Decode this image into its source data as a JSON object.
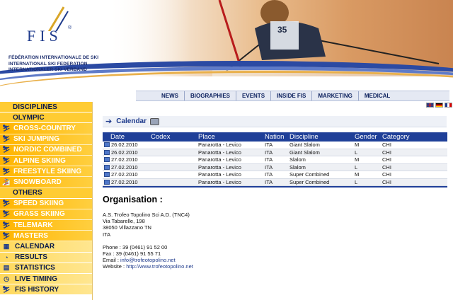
{
  "header": {
    "logo_text": "FIS",
    "logo_mark": "®",
    "federation_lines": [
      "FÉDÉRATION INTERNATIONALE DE SKI",
      "INTERNATIONAL SKI FEDERATION",
      "INTERNATIONALER SKI VERBAND"
    ],
    "photo_bib": "35"
  },
  "topnav": {
    "items": [
      "NEWS",
      "BIOGRAPHIES",
      "EVENTS",
      "INSIDE FIS",
      "MARKETING",
      "MEDICAL"
    ]
  },
  "languages": [
    "en",
    "de",
    "fr"
  ],
  "sidebar": {
    "disciplines_header": "DISCIPLINES",
    "olympic_header": "OLYMPIC",
    "olympic_items": [
      {
        "label": "CROSS-COUNTRY",
        "icon": "cross-country-icon"
      },
      {
        "label": "SKI JUMPING",
        "icon": "ski-jumping-icon"
      },
      {
        "label": "NORDIC COMBINED",
        "icon": "nordic-combined-icon"
      },
      {
        "label": "ALPINE SKIING",
        "icon": "alpine-skiing-icon"
      },
      {
        "label": "FREESTYLE SKIING",
        "icon": "freestyle-skiing-icon"
      },
      {
        "label": "SNOWBOARD",
        "icon": "snowboard-icon"
      }
    ],
    "others_header": "OTHERS",
    "other_items": [
      {
        "label": "SPEED SKIING",
        "icon": "speed-skiing-icon"
      },
      {
        "label": "GRASS SKIING",
        "icon": "grass-skiing-icon"
      },
      {
        "label": "TELEMARK",
        "icon": "telemark-icon"
      },
      {
        "label": "MASTERS",
        "icon": "masters-icon"
      }
    ],
    "extra_items": [
      {
        "label": "CALENDAR",
        "icon": "calendar-icon"
      },
      {
        "label": "RESULTS",
        "icon": "results-icon"
      },
      {
        "label": "STATISTICS",
        "icon": "statistics-icon"
      },
      {
        "label": "LIVE TIMING",
        "icon": "live-timing-icon"
      },
      {
        "label": "FIS HISTORY",
        "icon": "fis-history-icon"
      }
    ]
  },
  "main": {
    "section_title": "Calendar",
    "table": {
      "headers": {
        "date": "Date",
        "codex": "Codex",
        "place": "Place",
        "nation": "Nation",
        "discipline": "Discipline",
        "gender": "Gender",
        "category": "Category"
      },
      "rows": [
        {
          "date": "26.02.2010",
          "codex": "",
          "place": "Panarotta - Levico",
          "nation": "ITA",
          "discipline": "Giant Slalom",
          "gender": "M",
          "category": "CHI"
        },
        {
          "date": "26.02.2010",
          "codex": "",
          "place": "Panarotta - Levico",
          "nation": "ITA",
          "discipline": "Giant Slalom",
          "gender": "L",
          "category": "CHI"
        },
        {
          "date": "27.02.2010",
          "codex": "",
          "place": "Panarotta - Levico",
          "nation": "ITA",
          "discipline": "Slalom",
          "gender": "M",
          "category": "CHI"
        },
        {
          "date": "27.02.2010",
          "codex": "",
          "place": "Panarotta - Levico",
          "nation": "ITA",
          "discipline": "Slalom",
          "gender": "L",
          "category": "CHI"
        },
        {
          "date": "27.02.2010",
          "codex": "",
          "place": "Panarotta - Levico",
          "nation": "ITA",
          "discipline": "Super Combined",
          "gender": "M",
          "category": "CHI"
        },
        {
          "date": "27.02.2010",
          "codex": "",
          "place": "Panarotta - Levico",
          "nation": "ITA",
          "discipline": "Super Combined",
          "gender": "L",
          "category": "CHI"
        }
      ]
    },
    "organisation": {
      "title": "Organisation :",
      "name": "A.S. Trofeo Topolino Sci A.D. (TNC4)",
      "street": "Via Tabarelle, 198",
      "city": "38050 Villazzano TN",
      "country": "ITA",
      "phone": "Phone :  39 (0461) 91 52 00",
      "fax": "Fax :  39 (0461) 91 55 71",
      "email_label": "Email : ",
      "email": "info@trofeotopolino.net",
      "website_label": "Website : ",
      "website": "http://www.trofeotopolino.net"
    }
  },
  "colors": {
    "brand_blue": "#1f3f98",
    "sidebar_orange": "#ffb400",
    "sidebar_yellow": "#ffd95c"
  }
}
